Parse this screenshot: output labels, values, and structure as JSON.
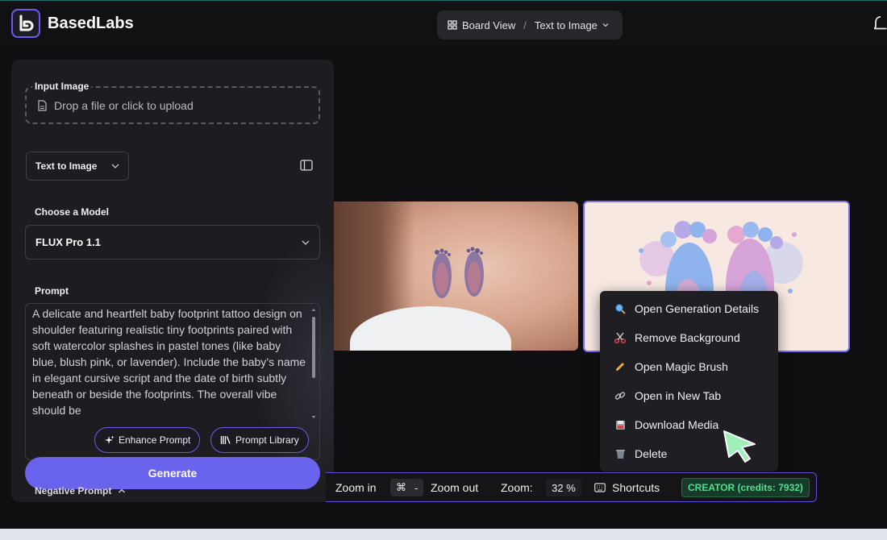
{
  "app": {
    "name": "BasedLabs"
  },
  "breadcrumb": {
    "board": "Board View",
    "separator": "/",
    "current": "Text to Image"
  },
  "input_image": {
    "label": "Input Image",
    "placeholder": "Drop a file or click to upload"
  },
  "mode": {
    "selected": "Text to Image"
  },
  "model": {
    "label": "Choose a Model",
    "selected": "FLUX Pro 1.1"
  },
  "prompt": {
    "label": "Prompt",
    "value": "A delicate and heartfelt baby footprint tattoo design on shoulder featuring realistic tiny footprints paired with soft watercolor splashes in pastel tones (like baby blue, blush pink, or lavender). Include the baby’s name in elegant cursive script and the date of birth subtly beneath or beside the footprints. The overall vibe should be",
    "enhance_label": "Enhance Prompt",
    "library_label": "Prompt Library"
  },
  "generate_label": "Generate",
  "negative_prompt_label": "Negative Prompt",
  "context_menu": [
    {
      "label": "Open Generation Details",
      "icon": "magnifier-icon"
    },
    {
      "label": "Remove Background",
      "icon": "scissors-icon"
    },
    {
      "label": "Open Magic Brush",
      "icon": "pencil-icon"
    },
    {
      "label": "Open in New Tab",
      "icon": "link-icon"
    },
    {
      "label": "Download Media",
      "icon": "floppy-disk-icon"
    },
    {
      "label": "Delete",
      "icon": "trash-icon"
    }
  ],
  "zoombar": {
    "zoom_in_label": "Zoom in",
    "cmd_key": "⌘",
    "minus_key": "-",
    "zoom_out_label": "Zoom out",
    "zoom_label": "Zoom:",
    "zoom_value": "32 %",
    "shortcuts_label": "Shortcuts",
    "plan_badge": "CREATOR (credits: 7932)"
  },
  "colors": {
    "accent": "#6a63ee",
    "badge_green": "#4ee08e",
    "cursor_green": "#9ef0b8"
  }
}
